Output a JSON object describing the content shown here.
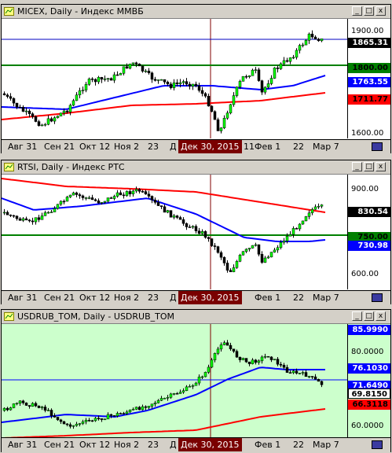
{
  "panels": [
    {
      "title": "MICEX, Daily - Индекс ММВБ",
      "yticks": [
        {
          "value": "1900.00",
          "top": 4
        },
        {
          "value": "1600.00",
          "top": 146
        }
      ],
      "price_flags": [
        {
          "value": "1865.31",
          "bg": "#000000",
          "fg": "#ffffff"
        },
        {
          "value": "1800.00",
          "bg": "#008000",
          "fg": "#000000"
        },
        {
          "value": "1763.55",
          "bg": "#0000ff",
          "fg": "#ffffff"
        },
        {
          "value": "1711.77",
          "bg": "#ff0000",
          "fg": "#000000"
        }
      ]
    },
    {
      "title": "RTSI, Daily - Индекс РТС",
      "yticks": [
        {
          "value": "900.00",
          "top": 15
        },
        {
          "value": "600.00",
          "top": 124
        }
      ],
      "price_flags": [
        {
          "value": "830.54",
          "bg": "#000000",
          "fg": "#ffffff"
        },
        {
          "value": "750.00",
          "bg": "#008000",
          "fg": "#000000"
        },
        {
          "value": "730.98",
          "bg": "#0000ff",
          "fg": "#ffffff"
        }
      ]
    },
    {
      "title": "USDRUB_TOM, Daily - USDRUB_TOM",
      "yticks": [
        {
          "value": "80.0000",
          "top": 38
        },
        {
          "value": "60.0000",
          "top": 134
        }
      ],
      "price_flags": [
        {
          "value": "85.9990",
          "bg": "#0000ff",
          "fg": "#ffffff"
        },
        {
          "value": "76.1030",
          "bg": "#0000ff",
          "fg": "#ffffff"
        },
        {
          "value": "71.6490",
          "bg": "#0000ff",
          "fg": "#ffffff"
        },
        {
          "value": "69.8150",
          "bg": "#ffffff",
          "fg": "#000000"
        },
        {
          "value": "66.3118",
          "bg": "#ff0000",
          "fg": "#000000"
        }
      ]
    }
  ],
  "xaxis": {
    "labels": [
      "Авг 31",
      "Сен 21",
      "Окт 12",
      "Ноя 2",
      "23",
      "Д",
      "11",
      "Фев 1",
      "22",
      "Мар 7"
    ],
    "cursor_label": "Дек 30, 2015"
  },
  "colors": {
    "candle_up": "#00ff00",
    "candle_down": "#000000",
    "ma_slow": "#ff0000",
    "ma_fast": "#0000ff",
    "level": "#008000",
    "plot3_bg": "#ccffcc"
  }
}
